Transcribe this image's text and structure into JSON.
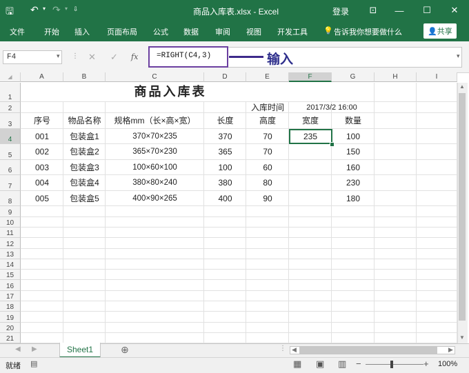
{
  "window": {
    "title": "商品入库表.xlsx - Excel",
    "login": "登录",
    "share_label": "共享",
    "tell_me": "告诉我你想要做什么"
  },
  "ribbon_tabs": [
    "文件",
    "开始",
    "插入",
    "页面布局",
    "公式",
    "数据",
    "审阅",
    "视图",
    "开发工具"
  ],
  "formula_bar": {
    "name_box": "F4",
    "fx_label": "fx",
    "formula": "=RIGHT(C4,3)",
    "annotation": "输入"
  },
  "columns": [
    "A",
    "B",
    "C",
    "D",
    "E",
    "F",
    "G",
    "H",
    "I"
  ],
  "selected_column": "F",
  "selected_row": "4",
  "rows": [
    "1",
    "2",
    "3",
    "4",
    "5",
    "6",
    "7",
    "8",
    "9",
    "10",
    "11",
    "12",
    "13",
    "14",
    "15",
    "16",
    "17",
    "18",
    "19",
    "20",
    "21"
  ],
  "sheet": {
    "title": "商品入库表",
    "time_label": "入库时间",
    "time_value": "2017/3/2 16:00",
    "headers": [
      "序号",
      "物品名称",
      "规格mm（长×高×宽）",
      "长度",
      "高度",
      "宽度",
      "数量"
    ],
    "data": [
      [
        "001",
        "包装盒1",
        "370×70×235",
        "370",
        "70",
        "235",
        "100"
      ],
      [
        "002",
        "包装盒2",
        "365×70×230",
        "365",
        "70",
        "",
        "150"
      ],
      [
        "003",
        "包装盒3",
        "100×60×100",
        "100",
        "60",
        "",
        "160"
      ],
      [
        "004",
        "包装盒4",
        "380×80×240",
        "380",
        "80",
        "",
        "230"
      ],
      [
        "005",
        "包装盒5",
        "400×90×265",
        "400",
        "90",
        "",
        "180"
      ]
    ]
  },
  "sheet_tabs": {
    "active": "Sheet1"
  },
  "status": {
    "ready": "就绪",
    "zoom": "100%"
  },
  "colors": {
    "accent": "#217346",
    "annotation": "#2e2f8c",
    "highlight_border": "#6b3fa0"
  }
}
